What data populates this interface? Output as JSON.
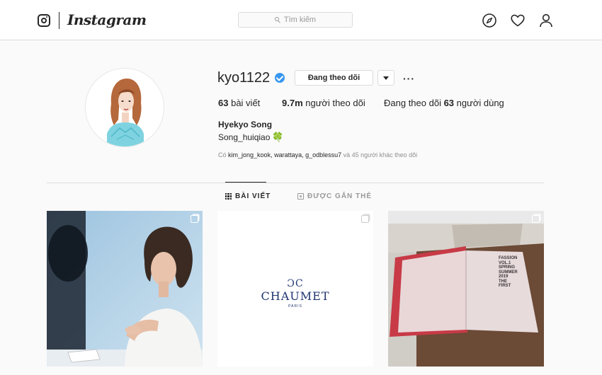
{
  "header": {
    "brand": "Instagram",
    "search_placeholder": "Tìm kiếm",
    "icons": [
      "instagram-icon",
      "search-icon",
      "compass-icon",
      "heart-icon",
      "profile-icon"
    ]
  },
  "profile": {
    "username": "kyo1122",
    "verified": true,
    "follow_button": "Đang theo dõi",
    "more": "···",
    "stats": {
      "posts_count": "63",
      "posts_label": "bài viết",
      "followers_count": "9.7m",
      "followers_label": "người theo dõi",
      "following_prefix": "Đang theo dõi",
      "following_count": "63",
      "following_label": "người dùng"
    },
    "full_name": "Hyekyo Song",
    "bio": "Song_huiqiao",
    "bio_emoji": "🍀",
    "followed_by_prefix": "Có",
    "followed_by_names": "kim_jong_kook, warattaya, g_odblessu7",
    "followed_by_suffix": "và 45 người khác theo dõi"
  },
  "tabs": [
    {
      "label": "BÀI VIẾT",
      "active": true
    },
    {
      "label": "ĐƯỢC GẮN THẺ",
      "active": false
    }
  ],
  "posts": [
    {
      "kind": "photo-portrait",
      "multi": true
    },
    {
      "kind": "chaumet-logo",
      "multi": true,
      "logo_text": "CHAUMET",
      "logo_sub": "PARIS",
      "logo_mark": "ƆC"
    },
    {
      "kind": "photo-book",
      "multi": true,
      "book_text": [
        "FASSION",
        "VOL.1",
        "SPRING",
        "SUMMER",
        "2019",
        "THE",
        "FIRST"
      ]
    }
  ],
  "colors": {
    "accent": "#3897f0",
    "text": "#262626",
    "muted": "#8e8e8e",
    "border": "#dbdbdb",
    "background": "#fafafa"
  }
}
